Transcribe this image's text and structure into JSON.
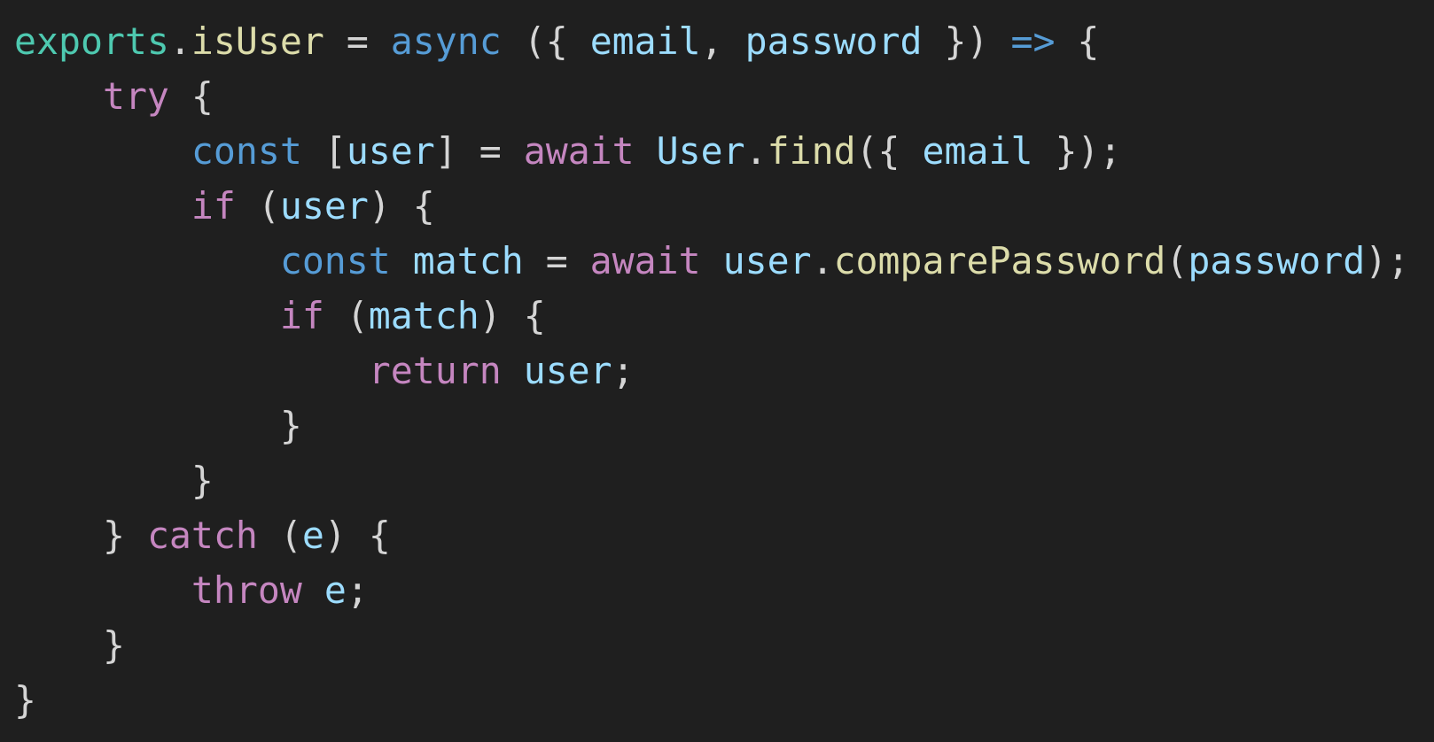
{
  "editor": {
    "background": "#1f1f1f",
    "theme_colors": {
      "plain": "#d4d4d4",
      "object": "#4ec9b0",
      "function": "#dcdcaa",
      "storage": "#569cd6",
      "variable": "#9cdcfe",
      "control": "#c586c0"
    },
    "lines": [
      [
        {
          "t": "exports",
          "k": "object"
        },
        {
          "t": ".",
          "k": "plain"
        },
        {
          "t": "isUser",
          "k": "function"
        },
        {
          "t": " = ",
          "k": "plain"
        },
        {
          "t": "async",
          "k": "storage"
        },
        {
          "t": " ({ ",
          "k": "plain"
        },
        {
          "t": "email",
          "k": "variable"
        },
        {
          "t": ", ",
          "k": "plain"
        },
        {
          "t": "password",
          "k": "variable"
        },
        {
          "t": " }) ",
          "k": "plain"
        },
        {
          "t": "=>",
          "k": "storage"
        },
        {
          "t": " {",
          "k": "plain"
        }
      ],
      [
        {
          "t": "    ",
          "k": "plain"
        },
        {
          "t": "try",
          "k": "control"
        },
        {
          "t": " {",
          "k": "plain"
        }
      ],
      [
        {
          "t": "        ",
          "k": "plain"
        },
        {
          "t": "const",
          "k": "storage"
        },
        {
          "t": " [",
          "k": "plain"
        },
        {
          "t": "user",
          "k": "variable"
        },
        {
          "t": "] = ",
          "k": "plain"
        },
        {
          "t": "await",
          "k": "control"
        },
        {
          "t": " ",
          "k": "plain"
        },
        {
          "t": "User",
          "k": "variable"
        },
        {
          "t": ".",
          "k": "plain"
        },
        {
          "t": "find",
          "k": "function"
        },
        {
          "t": "({ ",
          "k": "plain"
        },
        {
          "t": "email",
          "k": "variable"
        },
        {
          "t": " });",
          "k": "plain"
        }
      ],
      [
        {
          "t": "        ",
          "k": "plain"
        },
        {
          "t": "if",
          "k": "control"
        },
        {
          "t": " (",
          "k": "plain"
        },
        {
          "t": "user",
          "k": "variable"
        },
        {
          "t": ") {",
          "k": "plain"
        }
      ],
      [
        {
          "t": "            ",
          "k": "plain"
        },
        {
          "t": "const",
          "k": "storage"
        },
        {
          "t": " ",
          "k": "plain"
        },
        {
          "t": "match",
          "k": "variable"
        },
        {
          "t": " = ",
          "k": "plain"
        },
        {
          "t": "await",
          "k": "control"
        },
        {
          "t": " ",
          "k": "plain"
        },
        {
          "t": "user",
          "k": "variable"
        },
        {
          "t": ".",
          "k": "plain"
        },
        {
          "t": "comparePassword",
          "k": "function"
        },
        {
          "t": "(",
          "k": "plain"
        },
        {
          "t": "password",
          "k": "variable"
        },
        {
          "t": ");",
          "k": "plain"
        }
      ],
      [
        {
          "t": "            ",
          "k": "plain"
        },
        {
          "t": "if",
          "k": "control"
        },
        {
          "t": " (",
          "k": "plain"
        },
        {
          "t": "match",
          "k": "variable"
        },
        {
          "t": ") {",
          "k": "plain"
        }
      ],
      [
        {
          "t": "                ",
          "k": "plain"
        },
        {
          "t": "return",
          "k": "control"
        },
        {
          "t": " ",
          "k": "plain"
        },
        {
          "t": "user",
          "k": "variable"
        },
        {
          "t": ";",
          "k": "plain"
        }
      ],
      [
        {
          "t": "            ",
          "k": "plain"
        },
        {
          "t": "}",
          "k": "plain"
        }
      ],
      [
        {
          "t": "        ",
          "k": "plain"
        },
        {
          "t": "}",
          "k": "plain"
        }
      ],
      [
        {
          "t": "    ",
          "k": "plain"
        },
        {
          "t": "} ",
          "k": "plain"
        },
        {
          "t": "catch",
          "k": "control"
        },
        {
          "t": " (",
          "k": "plain"
        },
        {
          "t": "e",
          "k": "variable"
        },
        {
          "t": ") {",
          "k": "plain"
        }
      ],
      [
        {
          "t": "        ",
          "k": "plain"
        },
        {
          "t": "throw",
          "k": "control"
        },
        {
          "t": " ",
          "k": "plain"
        },
        {
          "t": "e",
          "k": "variable"
        },
        {
          "t": ";",
          "k": "plain"
        }
      ],
      [
        {
          "t": "    ",
          "k": "plain"
        },
        {
          "t": "}",
          "k": "plain"
        }
      ],
      [
        {
          "t": "}",
          "k": "plain"
        }
      ]
    ]
  }
}
